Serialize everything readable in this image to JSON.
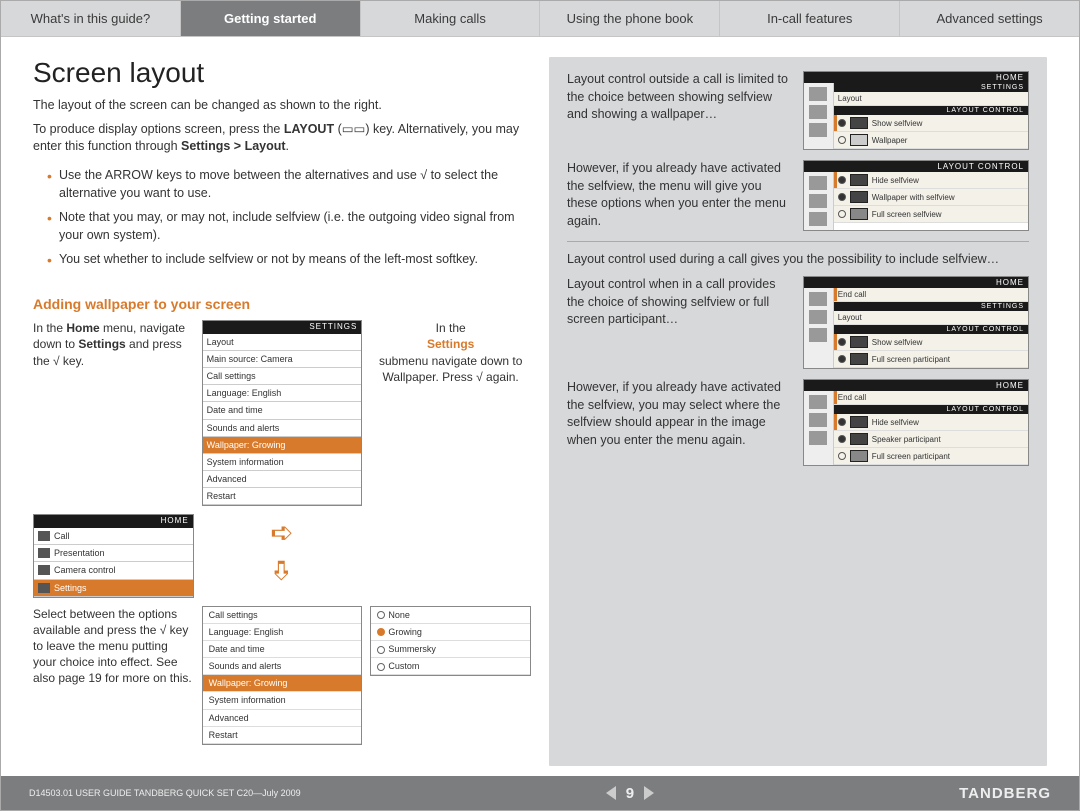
{
  "nav": {
    "items": [
      "What's in this guide?",
      "Getting started",
      "Making calls",
      "Using the phone book",
      "In-call features",
      "Advanced settings"
    ],
    "active_index": 1
  },
  "left": {
    "title": "Screen layout",
    "intro1": "The layout of the screen can be changed as shown to the right.",
    "intro2_a": "To produce display options screen, press the ",
    "intro2_key": "LAYOUT",
    "intro2_b": " (▭▭) key. Alternatively, you may enter this function through ",
    "intro2_path": "Settings > Layout",
    "intro2_c": ".",
    "bullets": [
      "Use the ARROW keys to move between the alternatives and use √ to select the alternative you want to use.",
      "Note that you may, or may not, include selfview (i.e. the outgoing video signal from your own system).",
      "You set whether to include selfview or not by means of the left-most softkey."
    ],
    "subhead": "Adding wallpaper to your screen",
    "flow": {
      "step1_a": "In the ",
      "step1_b": "Home",
      "step1_c": " menu, navigate down to ",
      "step1_d": "Settings",
      "step1_e": " and press the √ key.",
      "step2_a": "In the ",
      "step2_b": "Settings",
      "step2_c": " submenu navigate down to Wallpaper. Press √ again.",
      "step3": "Select between the options available and press the √ key to leave the menu putting your choice into effect. See also page 19 for more on this.",
      "home_menu": {
        "title": "HOME",
        "items": [
          "Call",
          "Presentation",
          "Camera control",
          "Settings"
        ],
        "hl": 3
      },
      "settings_menu": {
        "title": "SETTINGS",
        "items": [
          "Layout",
          "Main source: Camera",
          "Call settings",
          "Language: English",
          "Date and time",
          "Sounds and alerts",
          "Wallpaper: Growing",
          "System information",
          "Advanced",
          "Restart"
        ],
        "hl": 6
      },
      "settings_menu2": {
        "items": [
          "Call settings",
          "Language: English",
          "Date and time",
          "Sounds and alerts",
          "Wallpaper: Growing",
          "System information",
          "Advanced",
          "Restart"
        ]
      },
      "wallpaper_opts": [
        "None",
        "Growing",
        "Summersky",
        "Custom"
      ],
      "wallpaper_sel": 1
    }
  },
  "right": {
    "r1": "Layout control outside a call is limited to the choice between showing selfview and showing a wallpaper…",
    "r2": "However, if you already have activated the selfview, the menu will give you these options when you enter the menu again.",
    "r3": "Layout control used during a call gives you the possibility to include selfview…",
    "r4": "Layout control when in a call provides the choice of showing selfview or full screen participant…",
    "r5": "However, if you already have activated the selfview, you may select where the selfview should appear in the image when you enter the menu again.",
    "lc_labels": {
      "home": "HOME",
      "settings": "SETTINGS",
      "layout": "Layout",
      "layout_control": "LAYOUT CONTROL",
      "end_call": "End call",
      "show_selfview": "Show selfview",
      "wallpaper": "Wallpaper",
      "hide_selfview": "Hide selfview",
      "wallpaper_with_selfview": "Wallpaper with selfview",
      "full_screen_selfview": "Full screen selfview",
      "full_screen_participant": "Full screen participant",
      "speaker_participant": "Speaker participant"
    }
  },
  "footer": {
    "doc": "D14503.01 USER GUIDE TANDBERG QUICK SET C20—July 2009",
    "page": "9",
    "brand": "TANDBERG"
  }
}
